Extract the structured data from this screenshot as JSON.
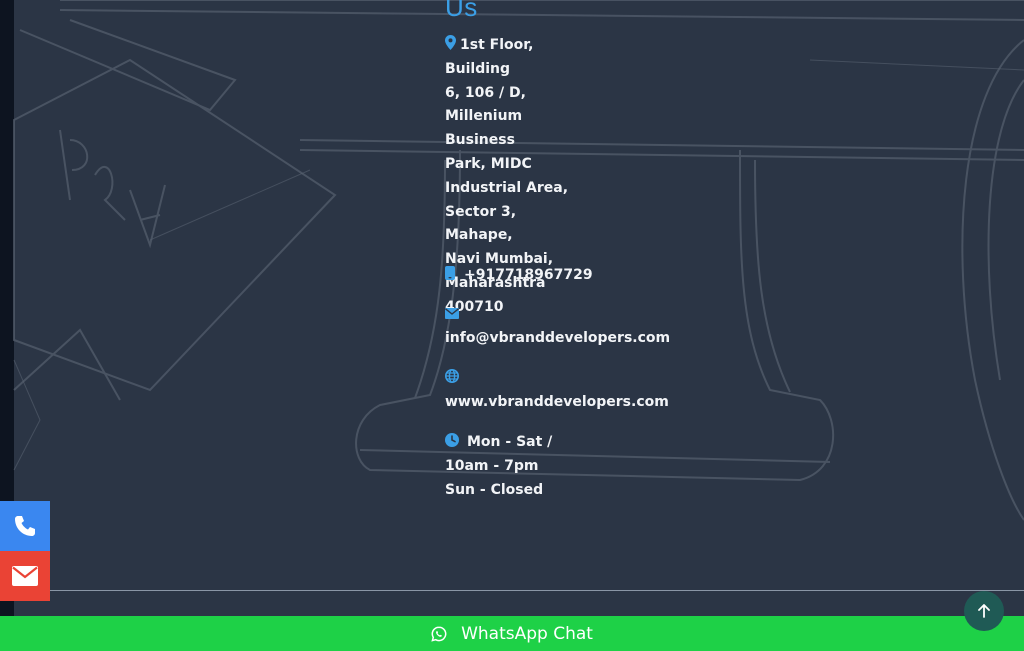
{
  "contact": {
    "heading": "Us",
    "address_lines": [
      "1st Floor, Building",
      "6, 106 / D,",
      "Millenium Business",
      "Park, MIDC",
      "Industrial Area,",
      "Sector 3, Mahape,",
      "Navi Mumbai,",
      "Maharashtra",
      "400710"
    ],
    "phone": "+917718967729",
    "email": "info@vbranddevelopers.com",
    "website": "www.vbranddevelopers.com",
    "hours_lines": [
      "Mon - Sat /",
      "10am - 7pm",
      "Sun - Closed"
    ]
  },
  "icons": {
    "address": "map-marker-icon",
    "phone": "mobile-phone-icon",
    "email": "envelope-icon",
    "website": "globe-icon",
    "hours": "clock-icon",
    "call_button": "phone-icon",
    "mail_button": "envelope-icon",
    "scroll_top": "arrow-up-icon",
    "whatsapp": "whatsapp-icon"
  },
  "whatsapp": {
    "label": "WhatsApp Chat"
  },
  "colors": {
    "background": "#2b3545",
    "accent": "#3b9fe6",
    "call_button": "#3a87f0",
    "mail_button": "#ea4335",
    "whatsapp_bar": "#1ed147",
    "scroll_top": "#1f5a55"
  }
}
